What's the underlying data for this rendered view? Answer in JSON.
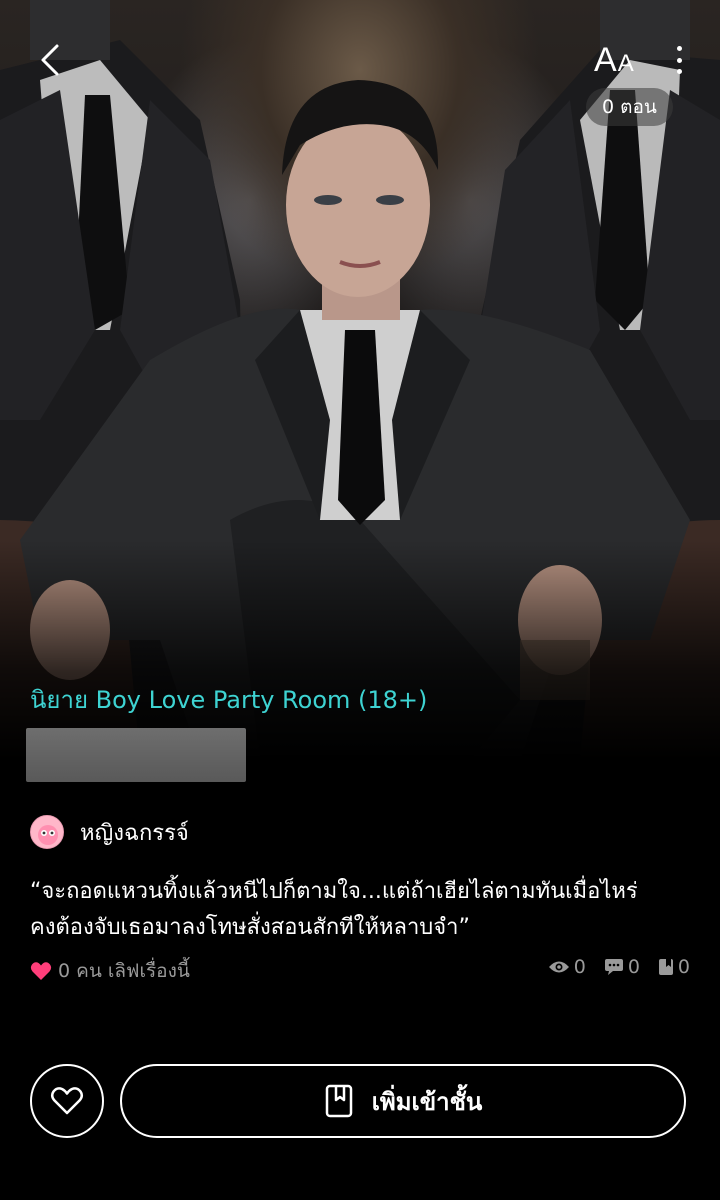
{
  "topbar": {
    "back_icon": "chevron-left-icon",
    "font_size_label_big": "A",
    "font_size_label_small": "A",
    "more_icon": "more-vertical-icon",
    "episode_count": "0 ตอน"
  },
  "novel": {
    "genre": "นิยาย Boy Love Party Room (18+)",
    "author": "หญิงฉกรรจ์",
    "synopsis_line1": "“จะถอดแหวนทิ้งแล้วหนีไปก็ตามใจ...แต่ถ้าเฮียไล่ตามทันเมื่อไหร่",
    "synopsis_line2": "คงต้องจับเธอมาลงโทษสั่งสอนสักทีให้หลาบจำ”"
  },
  "stats": {
    "love_text": "0 คน เลิฟเรื่องนี้",
    "views": "0",
    "comments": "0",
    "bookmarks": "0"
  },
  "actions": {
    "add_to_shelf_label": "เพิ่มเข้าชั้น"
  },
  "colors": {
    "accent_teal": "#3ed3d2",
    "heart_pink": "#ff3e7a",
    "background": "#000000"
  }
}
